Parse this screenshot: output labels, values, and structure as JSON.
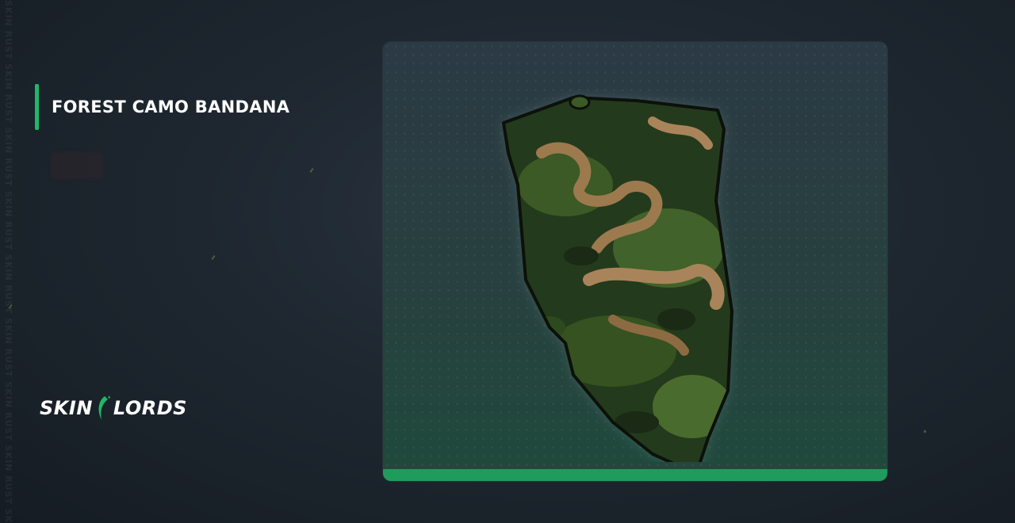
{
  "side_text": "SKIN RUST SKIN RUST SKIN RUST SKIN RUST SKIN RUST SKIN RUST SKIN RUST SKIN RUST SKIN RUST SKIN RUST SKIN RUST SKIN RUST",
  "item": {
    "title": "FOREST CAMO BANDANA",
    "image_icon": "camo-bandana-image"
  },
  "brand": {
    "left": "SKIN",
    "right": "LORDS",
    "logo_icon": "claw-icon"
  },
  "colors": {
    "accent": "#1fb868",
    "card_bar": "#1f9c5c",
    "background": "#1e2730"
  }
}
